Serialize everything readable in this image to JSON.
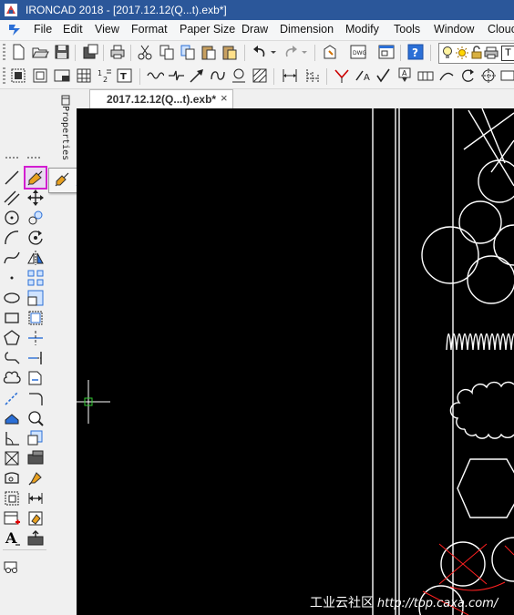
{
  "window": {
    "title": "IRONCAD 2018 - [2017.12.12(Q...t).exb*]"
  },
  "menu": [
    "File",
    "Edit",
    "View",
    "Format",
    "Paper Size",
    "Draw",
    "Dimension",
    "Modify",
    "Tools",
    "Window",
    "Clouc"
  ],
  "document_tab": {
    "label": "2017.12.12(Q...t).exb*",
    "close": "×"
  },
  "side_panel": {
    "label": "Properties"
  },
  "left_toolbar": {
    "text_tool_glyph": "A"
  },
  "toolbar1": {
    "text_box_label": "T"
  },
  "watermark": {
    "cn": "工业云社区",
    "url": "http://top.caxa.com/"
  },
  "colors": {
    "canvas": "#000000",
    "geometry": "#ffffff",
    "cursor": "#33cc33",
    "highlight": "#d21dd0",
    "titlebar": "#2b579a",
    "construction": "#ff2020"
  }
}
